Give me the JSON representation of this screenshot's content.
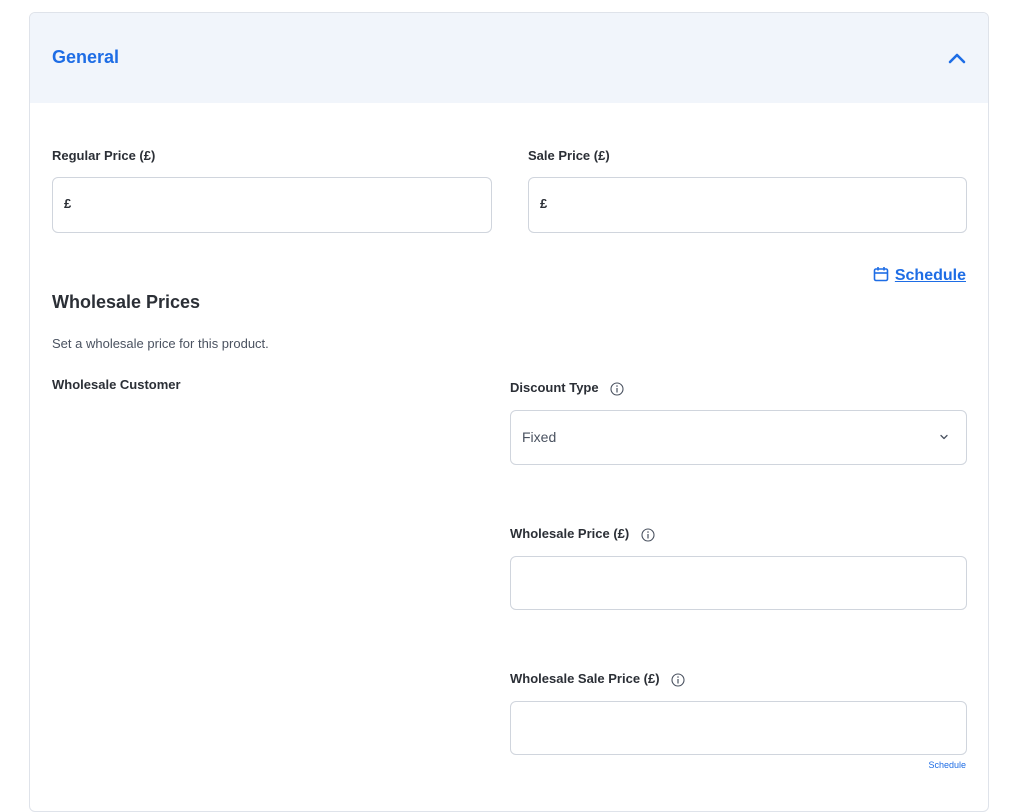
{
  "header": {
    "title": "General",
    "collapse_icon": "chevron-up-icon"
  },
  "pricing": {
    "regular_price_label": "Regular Price (£)",
    "regular_price_prefix": "£",
    "regular_price_value": "",
    "sale_price_label": "Sale Price (£)",
    "sale_price_prefix": "£",
    "sale_price_value": "",
    "schedule_label": "Schedule",
    "schedule_icon": "calendar-icon"
  },
  "wholesale": {
    "title": "Wholesale Prices",
    "description": "Set a wholesale price for this product.",
    "customer_label": "Wholesale Customer",
    "discount_type_label": "Discount Type",
    "discount_type_value": "Fixed",
    "wholesale_price_label": "Wholesale Price (£)",
    "wholesale_price_value": "",
    "wholesale_sale_price_label": "Wholesale Sale Price (£)",
    "wholesale_sale_price_value": "",
    "schedule_label": "Schedule"
  },
  "colors": {
    "accent": "#1e6de5",
    "header_bg": "#f1f5fb",
    "border": "#d0d5dd"
  }
}
